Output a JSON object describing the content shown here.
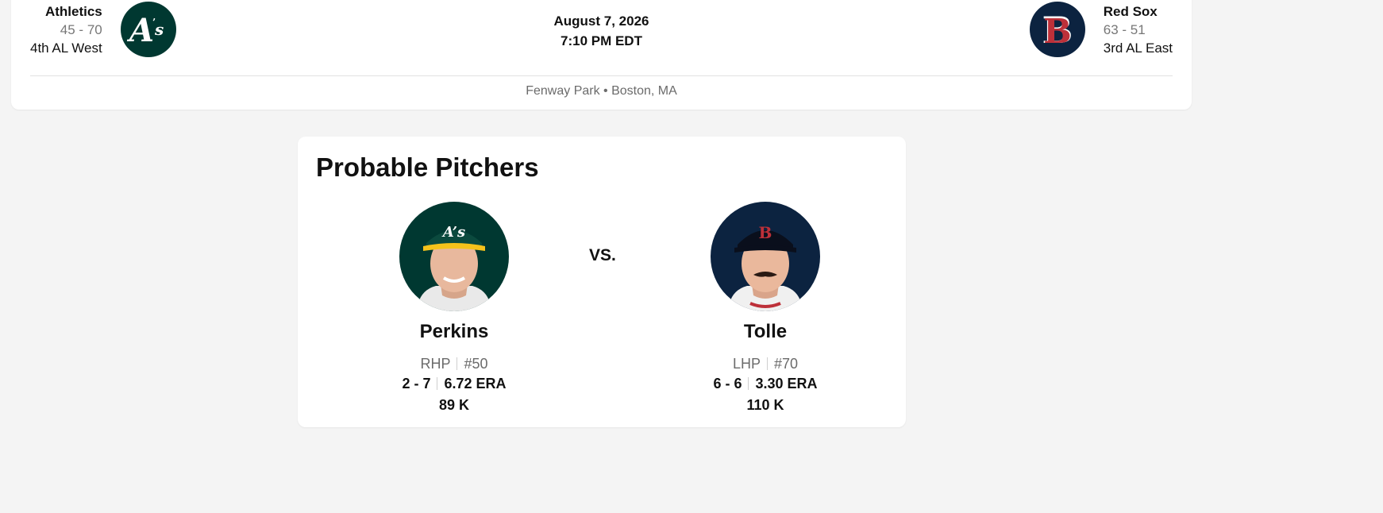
{
  "game": {
    "away": {
      "name": "Athletics",
      "record": "45 - 70",
      "standing": "4th AL West",
      "logo_icon": "athletics-logo-icon",
      "color": "#003831"
    },
    "home": {
      "name": "Red Sox",
      "record": "63 - 51",
      "standing": "3rd AL East",
      "logo_icon": "red-sox-logo-icon",
      "color": "#0c2340"
    },
    "date": "August 7, 2026",
    "time": "7:10 PM EDT",
    "venue": "Fenway Park • Boston, MA"
  },
  "probable_pitchers": {
    "title": "Probable Pitchers",
    "vs_label": "VS.",
    "away": {
      "name": "Perkins",
      "throws": "RHP",
      "number": "#50",
      "record": "2 - 7",
      "era": "6.72 ERA",
      "strikeouts": "89 K"
    },
    "home": {
      "name": "Tolle",
      "throws": "LHP",
      "number": "#70",
      "record": "6 - 6",
      "era": "3.30 ERA",
      "strikeouts": "110 K"
    }
  }
}
